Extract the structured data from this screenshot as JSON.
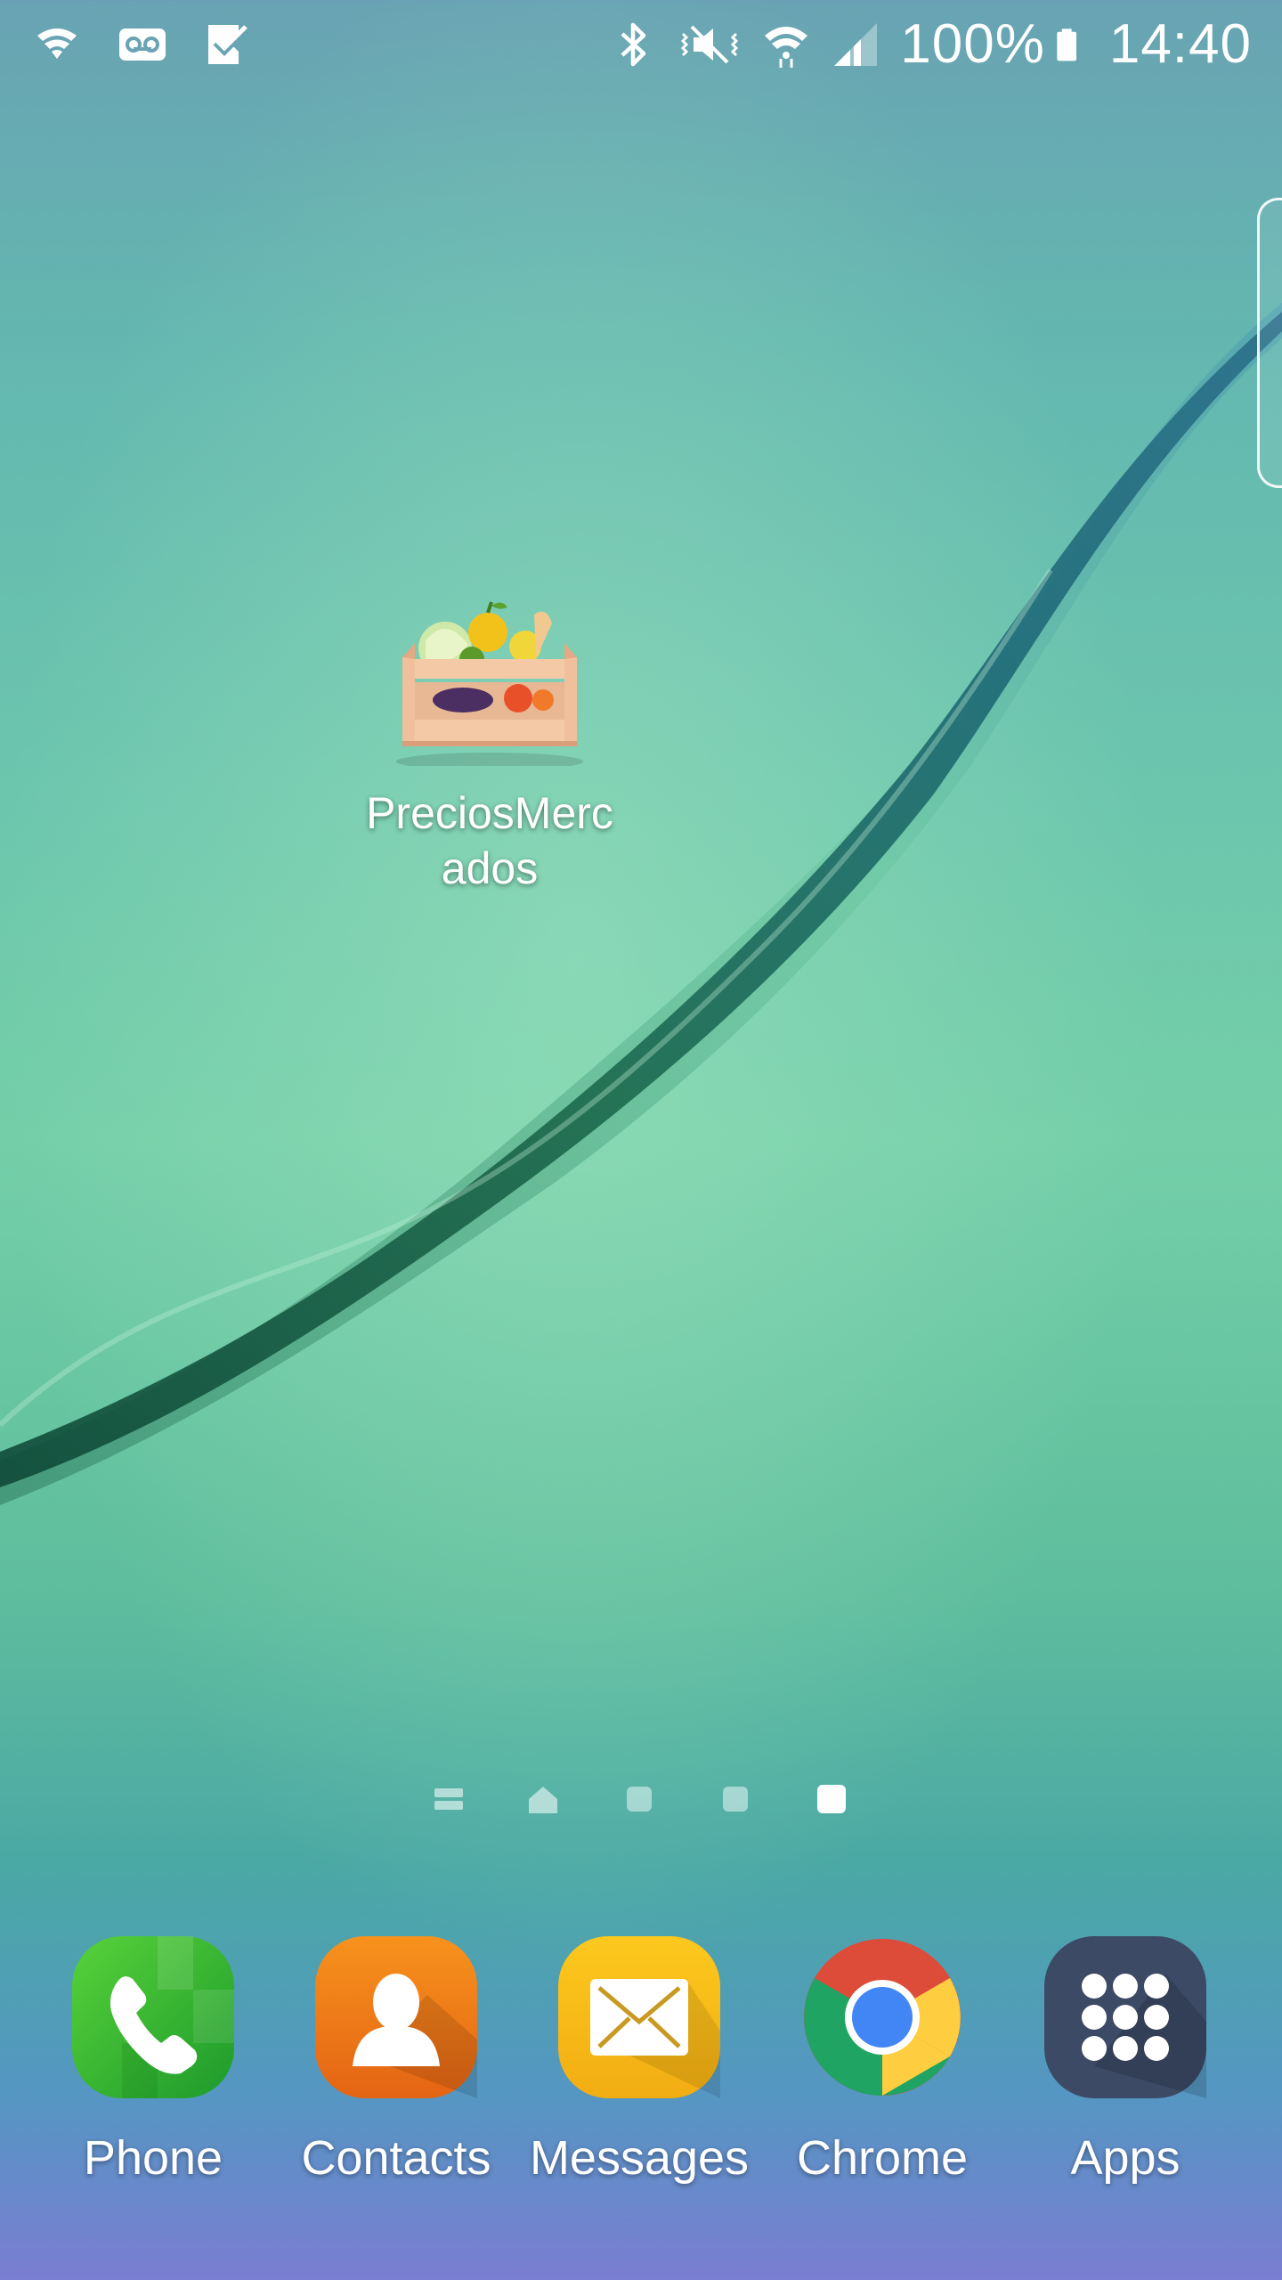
{
  "status_bar": {
    "left_icons": [
      "wifi-calling-icon",
      "voicemail-icon",
      "task-check-icon"
    ],
    "right_icons": [
      "bluetooth-icon",
      "vibrate-icon",
      "wifi-icon",
      "signal-icon"
    ],
    "battery": "100%",
    "time": "14:40"
  },
  "home": {
    "shortcut": {
      "label": "PreciosMerc\nados",
      "icon": "fruit-crate-icon"
    },
    "pages": {
      "indicators": [
        "menu-page",
        "home-page",
        "page",
        "page",
        "page"
      ],
      "active_index": 4
    }
  },
  "dock": {
    "items": [
      {
        "label": "Phone",
        "icon": "phone-icon"
      },
      {
        "label": "Contacts",
        "icon": "contacts-icon"
      },
      {
        "label": "Messages",
        "icon": "messages-icon"
      },
      {
        "label": "Chrome",
        "icon": "chrome-icon"
      },
      {
        "label": "Apps",
        "icon": "apps-grid-icon"
      }
    ]
  },
  "colors": {
    "phone": "#3fbf2e",
    "contacts": "#f07a18",
    "messages": "#f7b818",
    "apps": "#3d4a66"
  }
}
